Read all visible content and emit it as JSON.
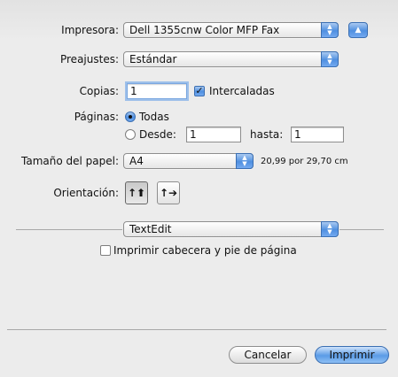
{
  "printer": {
    "label": "Impresora:",
    "value": "Dell 1355cnw Color MFP Fax"
  },
  "presets": {
    "label": "Preajustes:",
    "value": "Estándar"
  },
  "copies": {
    "label": "Copias:",
    "value": "1",
    "collated_label": "Intercaladas",
    "collated_checked": true
  },
  "pages": {
    "label": "Páginas:",
    "all_label": "Todas",
    "from_label": "Desde:",
    "from_value": "1",
    "to_label": "hasta:",
    "to_value": "1",
    "selected": "all"
  },
  "paper_size": {
    "label": "Tamaño del papel:",
    "value": "A4",
    "dimensions": "20,99 por 29,70 cm"
  },
  "orientation": {
    "label": "Orientación:",
    "selected": "portrait"
  },
  "section": {
    "value": "TextEdit"
  },
  "header_footer": {
    "label": "Imprimir cabecera y pie de página",
    "checked": false
  },
  "buttons": {
    "cancel": "Cancelar",
    "print": "Imprimir"
  },
  "colors": {
    "accent": "#4f8fe0",
    "background": "#ececec"
  }
}
